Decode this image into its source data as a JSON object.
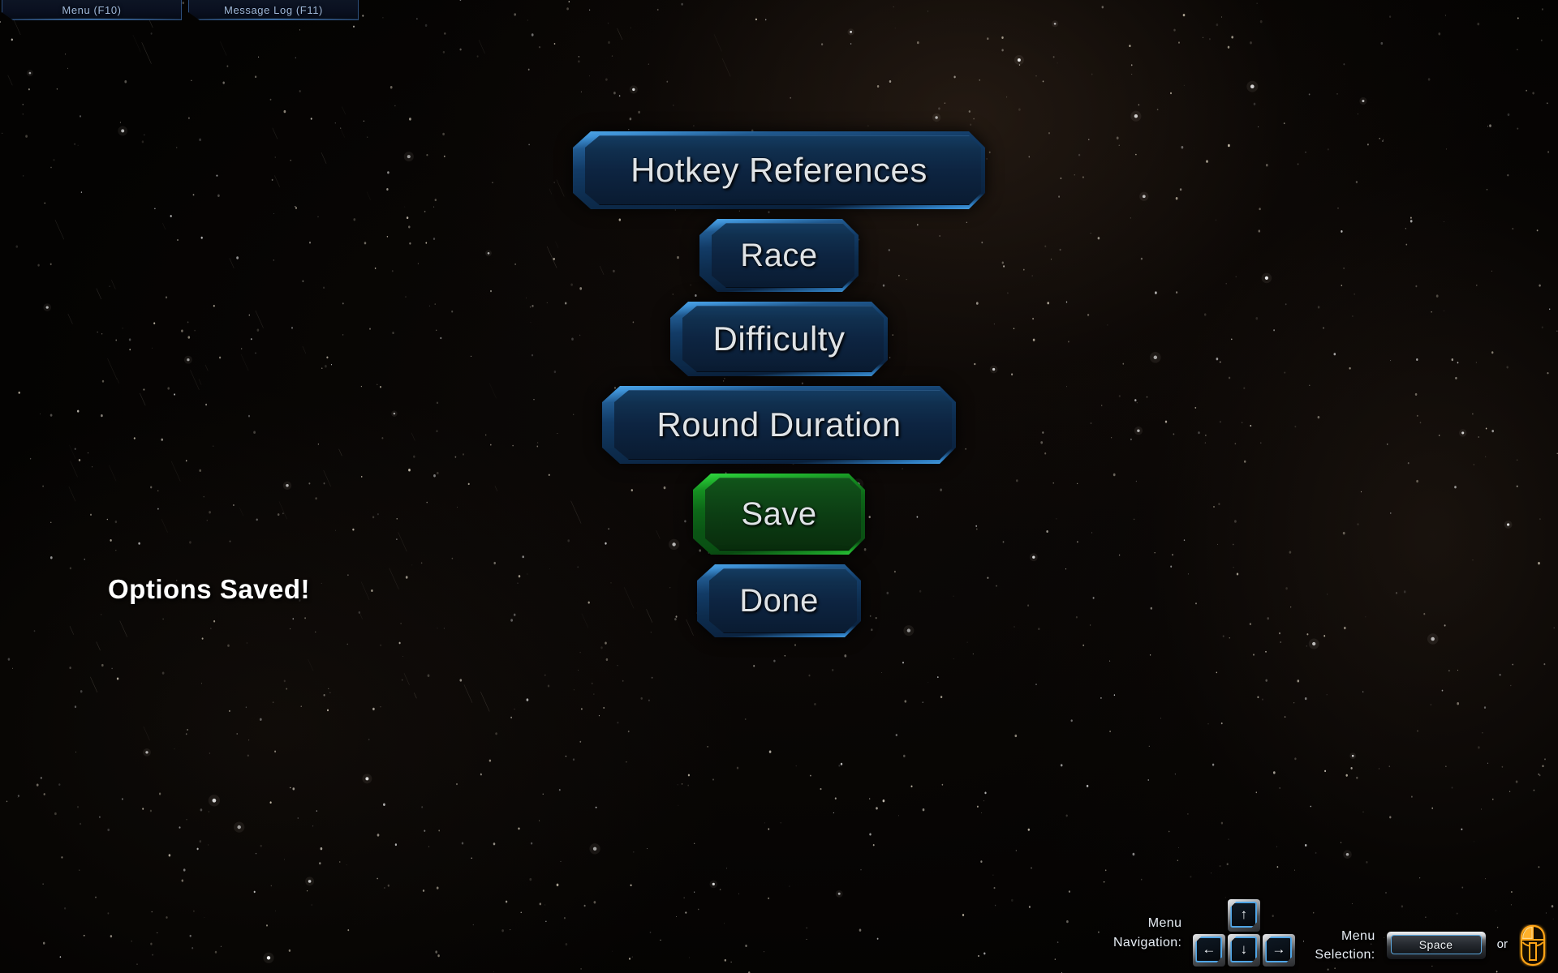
{
  "window": {
    "title": "Game Options Menu",
    "background_color": "#080605"
  },
  "topbar": {
    "tabs": [
      {
        "label": "Menu (F10)",
        "hotkey": "F10",
        "name": "tab-menu"
      },
      {
        "label": "Message Log (F11)",
        "hotkey": "F11",
        "name": "tab-message-log"
      }
    ]
  },
  "menu": {
    "buttons": [
      {
        "label": "Hotkey References",
        "color": "#2f7fc4",
        "variant": "blue"
      },
      {
        "label": "Race",
        "color": "#2f7fc4",
        "variant": "blue"
      },
      {
        "label": "Difficulty",
        "color": "#2f7fc4",
        "variant": "blue"
      },
      {
        "label": "Round Duration",
        "color": "#2f7fc4",
        "variant": "blue"
      },
      {
        "label": "Save",
        "color": "#25c033",
        "variant": "green"
      },
      {
        "label": "Done",
        "color": "#2f7fc4",
        "variant": "blue"
      }
    ]
  },
  "status": {
    "message": "Options Saved!",
    "color": "#ffffff"
  },
  "hints": {
    "navigation": {
      "line1": "Menu",
      "line2": "Navigation:",
      "keys": {
        "up": "↑",
        "down": "↓",
        "left": "←",
        "right": "→"
      }
    },
    "selection": {
      "line1": "Menu",
      "line2": "Selection:",
      "key": "Space",
      "or": "or",
      "mouse_icon": "mouse-left-click-icon",
      "mouse_color": "#ffa415"
    }
  }
}
